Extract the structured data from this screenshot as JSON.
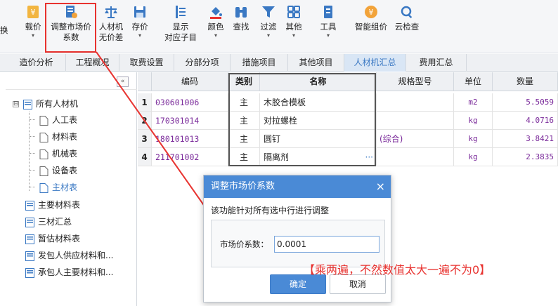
{
  "ribbon": {
    "partial_left": "换",
    "items": [
      {
        "label1": "载价",
        "caret": "▾",
        "icon": "price-load-icon",
        "color": "#e8a23a"
      },
      {
        "label1": "调整市场价",
        "label2": "系数",
        "icon": "adjust-coefficient-icon",
        "color": "#3a78c3"
      },
      {
        "label1": "人材机",
        "label2": "无价差",
        "icon": "scale-icon",
        "color": "#3a78c3"
      },
      {
        "label1": "存价",
        "caret": "▾",
        "icon": "save-price-icon",
        "color": "#3a78c3"
      },
      {
        "label1": "显示",
        "label2": "对应子目",
        "icon": "show-subitem-icon",
        "color": "#3a78c3"
      },
      {
        "label1": "颜色",
        "caret": "▾",
        "icon": "color-bucket-icon",
        "color": "#3a78c3"
      },
      {
        "label1": "查找",
        "icon": "binoculars-icon",
        "color": "#3a78c3"
      },
      {
        "label1": "过滤",
        "caret": "▾",
        "icon": "filter-icon",
        "color": "#3a78c3"
      },
      {
        "label1": "其他",
        "caret": "▾",
        "icon": "grid-apps-icon",
        "color": "#3a78c3"
      },
      {
        "label1": "工具",
        "caret": "▾",
        "icon": "toolbox-icon",
        "color": "#3a78c3"
      },
      {
        "label1": "智能组价",
        "icon": "smart-price-icon",
        "color": "#e8a23a"
      },
      {
        "label1": "云检查",
        "icon": "cloud-check-icon",
        "color": "#3a78c3"
      }
    ]
  },
  "tabs": [
    "造价分析",
    "工程概况",
    "取费设置",
    "分部分项",
    "措施项目",
    "其他项目",
    "人材机汇总",
    "费用汇总"
  ],
  "active_tab": "人材机汇总",
  "tree": {
    "collapse_glyph": "«",
    "expand_glyph": "⊟",
    "items": [
      {
        "label": "所有人材机",
        "level": 0
      },
      {
        "label": "人工表",
        "level": 1
      },
      {
        "label": "材料表",
        "level": 1
      },
      {
        "label": "机械表",
        "level": 1
      },
      {
        "label": "设备表",
        "level": 1
      },
      {
        "label": "主材表",
        "level": 1
      },
      {
        "label": "主要材料表",
        "level": 0
      },
      {
        "label": "三材汇总",
        "level": 0
      },
      {
        "label": "暂估材料表",
        "level": 0
      },
      {
        "label": "发包人供应材料和...",
        "level": 0
      },
      {
        "label": "承包人主要材料和...",
        "level": 0
      }
    ],
    "selected": "主材表"
  },
  "grid": {
    "headers": [
      "编码",
      "类别",
      "名称",
      "规格型号",
      "单位",
      "数量"
    ],
    "rows": [
      {
        "num": "1",
        "code": "030601006",
        "category": "主",
        "name": "木胶合模板",
        "spec": "",
        "unit": "m2",
        "qty": "5.5059"
      },
      {
        "num": "2",
        "code": "170301014",
        "category": "主",
        "name": "对拉螺栓",
        "spec": "",
        "unit": "kg",
        "qty": "4.0716"
      },
      {
        "num": "3",
        "code": "180101013",
        "category": "主",
        "name": "圆钉",
        "spec": "(综合)",
        "unit": "kg",
        "qty": "3.8421"
      },
      {
        "num": "4",
        "code": "211701002",
        "category": "主",
        "name": "隔离剂",
        "spec": "",
        "unit": "kg",
        "qty": "2.3835"
      }
    ],
    "ellipsis": "···"
  },
  "dialog": {
    "title": "调整市场价系数",
    "close": "×",
    "message": "该功能针对所有选中行进行调整",
    "field_label": "市场价系数：",
    "field_value": "0.0001",
    "ok": "确定",
    "cancel": "取消"
  },
  "annotation": "【乘两遍，不然数值太大一遍不为0】",
  "colors": {
    "accent": "#4a8ad6",
    "highlight": "#e8322f",
    "purple_text": "#7a2a9a"
  }
}
